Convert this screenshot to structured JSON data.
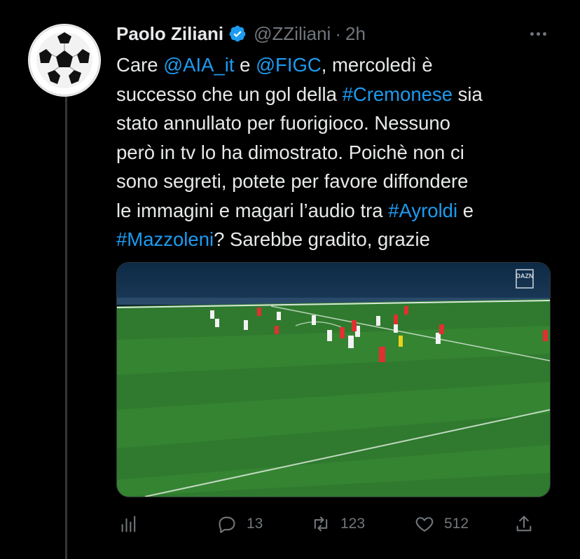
{
  "author": {
    "name": "Paolo Ziliani",
    "handle": "@ZZiliani",
    "separator": "·",
    "time": "2h",
    "verified": true,
    "avatar_icon": "soccer-ball-icon"
  },
  "tweet": {
    "segments": [
      [
        {
          "t": "Care ",
          "k": "text"
        },
        {
          "t": "@AIA_it",
          "k": "link"
        },
        {
          "t": " e ",
          "k": "text"
        },
        {
          "t": "@FIGC",
          "k": "link"
        },
        {
          "t": ", mercoledì è",
          "k": "text"
        }
      ],
      [
        {
          "t": "successo che un gol della ",
          "k": "text"
        },
        {
          "t": "#Cremonese",
          "k": "link"
        },
        {
          "t": " sia",
          "k": "text"
        }
      ],
      [
        {
          "t": "stato annullato per fuorigioco. Nessuno",
          "k": "text"
        }
      ],
      [
        {
          "t": "però in tv lo ha dimostrato. Poichè non ci",
          "k": "text"
        }
      ],
      [
        {
          "t": "sono segreti, potete per favore diffondere",
          "k": "text"
        }
      ],
      [
        {
          "t": "le immagini e magari l’audio tra ",
          "k": "text"
        },
        {
          "t": "#Ayroldi",
          "k": "link"
        },
        {
          "t": " e",
          "k": "text"
        }
      ],
      [
        {
          "t": "#Mazzoleni",
          "k": "link"
        },
        {
          "t": "? Sarebbe gradito, grazie",
          "k": "text"
        }
      ]
    ]
  },
  "media": {
    "broadcaster_logo": "DAZN",
    "description_icon": "football-match-image"
  },
  "actions": {
    "analytics_icon": "analytics-icon",
    "reply_count": "13",
    "retweet_count": "123",
    "like_count": "512",
    "share_icon": "share-icon"
  },
  "colors": {
    "background": "#000000",
    "text": "#e7e9ea",
    "secondary": "#71767b",
    "link": "#1d9bf0",
    "verified": "#1d9bf0",
    "thread_line": "#333639"
  }
}
